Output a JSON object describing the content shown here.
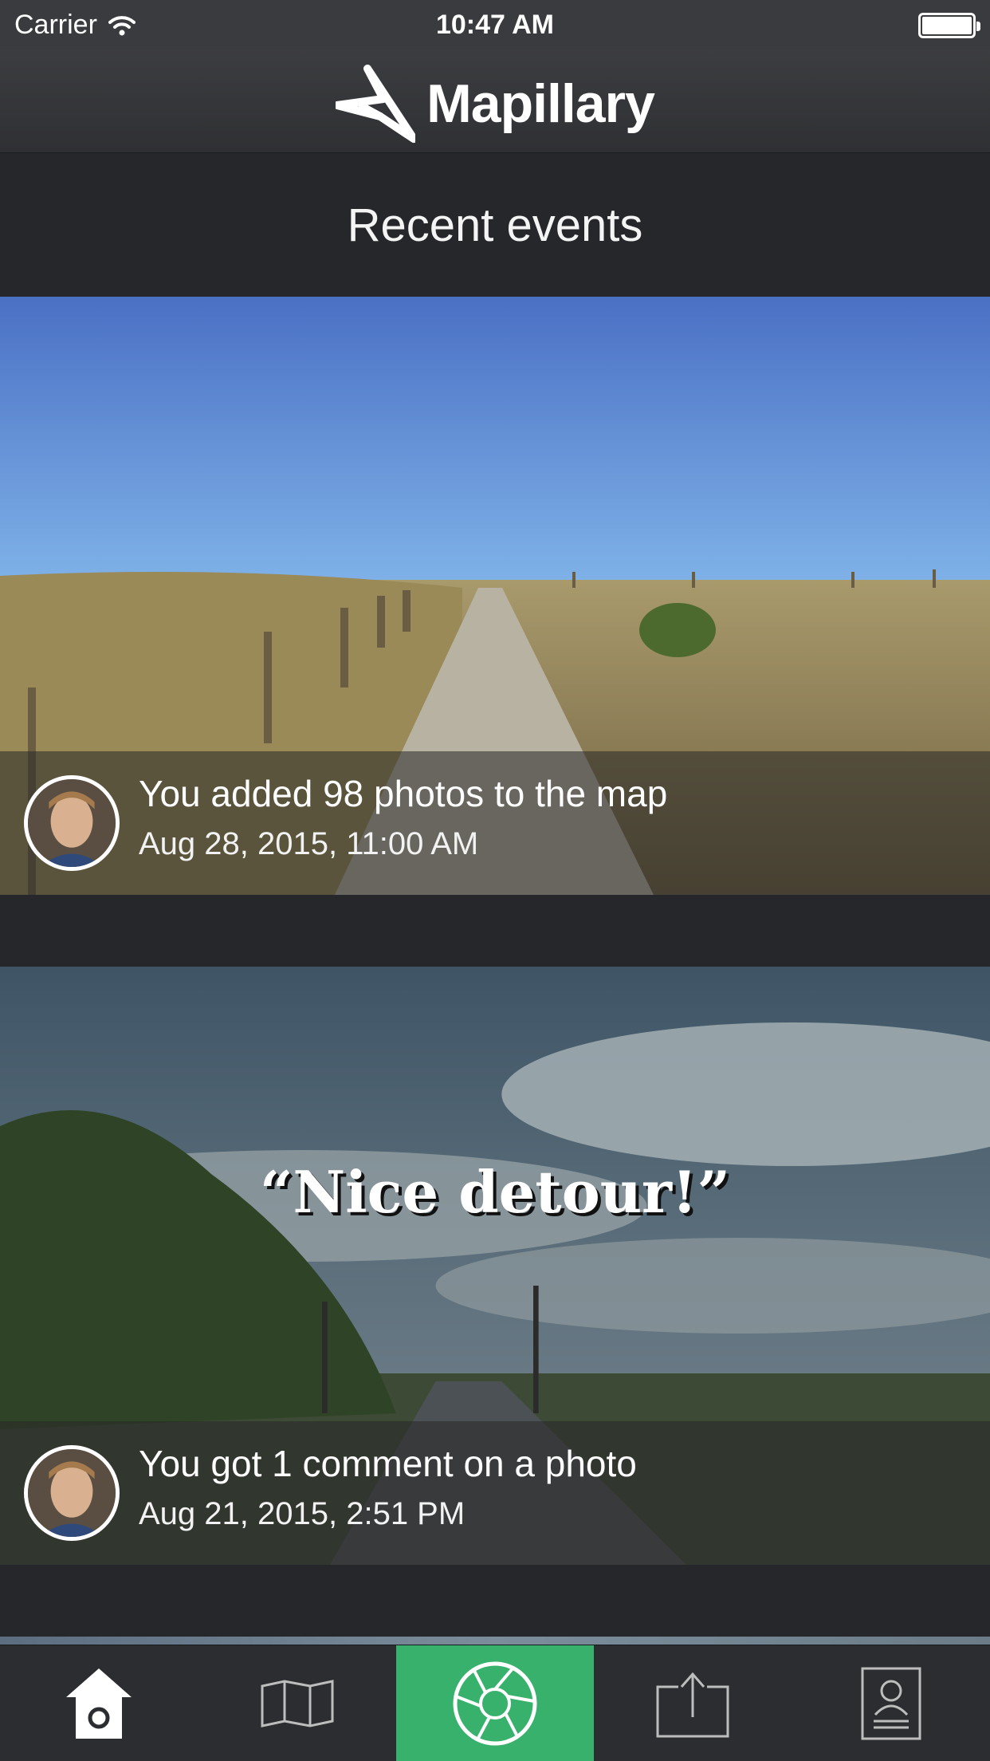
{
  "status_bar": {
    "carrier": "Carrier",
    "time": "10:47 AM"
  },
  "header": {
    "brand": "Mapillary"
  },
  "section": {
    "title": "Recent events"
  },
  "events": [
    {
      "title": "You added 98 photos to the map",
      "timestamp": "Aug 28, 2015, 11:00 AM"
    },
    {
      "quote": "“Nice detour!”",
      "title": "You got 1 comment on a photo",
      "timestamp": "Aug 21, 2015, 2:51 PM"
    }
  ],
  "tab_bar": {
    "tabs": [
      {
        "icon": "home-icon"
      },
      {
        "icon": "map-icon"
      },
      {
        "icon": "camera-shutter-icon",
        "active": true
      },
      {
        "icon": "upload-icon"
      },
      {
        "icon": "profile-icon"
      }
    ],
    "active_color": "#38b16d"
  },
  "colors": {
    "background": "#25272b",
    "nav": "#3a3b3e",
    "accent": "#38b16d"
  }
}
